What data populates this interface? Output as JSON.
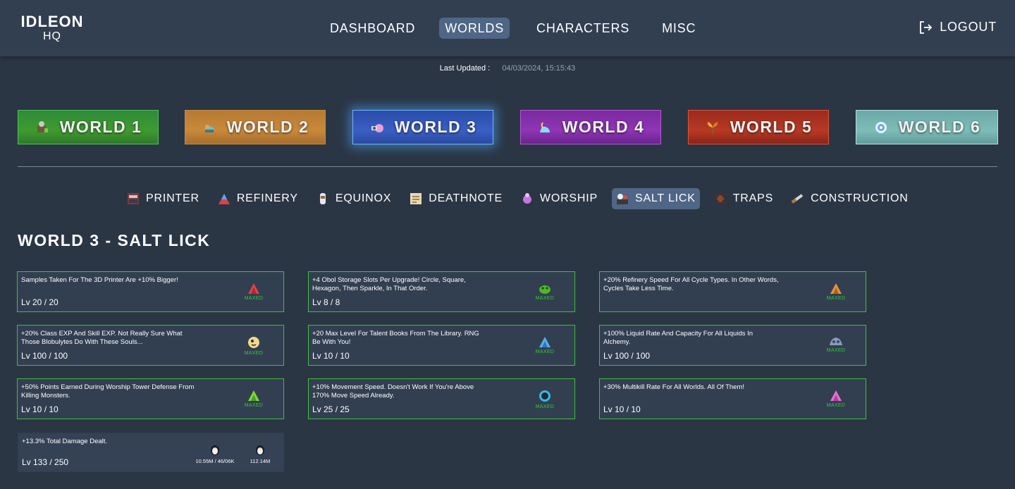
{
  "header": {
    "logo_line1": "IDLEON",
    "logo_line2": "HQ",
    "nav": [
      {
        "label": "DASHBOARD",
        "active": false
      },
      {
        "label": "WORLDS",
        "active": true
      },
      {
        "label": "CHARACTERS",
        "active": false
      },
      {
        "label": "MISC",
        "active": false
      }
    ],
    "logout_label": "LOGOUT"
  },
  "last_updated": {
    "label": "Last Updated :",
    "value": "04/03/2024, 15:15:43"
  },
  "worlds": [
    {
      "label": "WORLD 1",
      "icon": "world1-icon",
      "color": "#3f9b2f"
    },
    {
      "label": "WORLD 2",
      "icon": "world2-icon",
      "color": "#c9893a"
    },
    {
      "label": "WORLD 3",
      "icon": "world3-icon",
      "color": "#3a5fc4",
      "active": true
    },
    {
      "label": "WORLD 4",
      "icon": "world4-icon",
      "color": "#8f36b4"
    },
    {
      "label": "WORLD 5",
      "icon": "world5-icon",
      "color": "#b83a24"
    },
    {
      "label": "WORLD 6",
      "icon": "world6-icon",
      "color": "#7ebcb8"
    }
  ],
  "subnav": [
    {
      "label": "PRINTER",
      "icon": "printer-icon"
    },
    {
      "label": "REFINERY",
      "icon": "refinery-icon"
    },
    {
      "label": "EQUINOX",
      "icon": "equinox-icon"
    },
    {
      "label": "DEATHNOTE",
      "icon": "deathnote-icon"
    },
    {
      "label": "WORSHIP",
      "icon": "worship-icon"
    },
    {
      "label": "SALT LICK",
      "icon": "salt-lick-icon",
      "active": true
    },
    {
      "label": "TRAPS",
      "icon": "traps-icon"
    },
    {
      "label": "CONSTRUCTION",
      "icon": "construction-icon"
    }
  ],
  "page_title": "WORLD 3 - SALT LICK",
  "maxed_label": "MAXED",
  "colors": {
    "maxed_border": "#3fbf3f",
    "maxed_text": "#36c936",
    "background": "#2b3645",
    "panel": "#323f51",
    "active_tab": "#4f6686"
  },
  "cards": [
    {
      "desc": "Samples Taken For The 3D Printer Are +10% Bigger!",
      "level": "Lv 20 / 20",
      "icon": "red-salt-icon"
    },
    {
      "desc": "+4 Obol Storage Slots Per Upgrade! Circle, Square, Hexagon, Then Sparkle, In That Order.",
      "level": "Lv 8 / 8",
      "icon": "green-slime-icon"
    },
    {
      "desc": "+20% Refinery Speed For All Cycle Types. In Other Words, Cycles Take Less Time.",
      "level": "",
      "icon": "orange-salt-icon"
    },
    {
      "desc": "+20% Class EXP And Skill EXP. Not Really Sure What Those Blobulytes Do With These Souls...",
      "level": "Lv 100 / 100",
      "icon": "soul-icon"
    },
    {
      "desc": "+20 Max Level For Talent Books From The Library. RNG Be With You!",
      "level": "Lv 10 / 10",
      "icon": "blue-salt-icon"
    },
    {
      "desc": "+100% Liquid Rate And Capacity For All Liquids In Alchemy.",
      "level": "Lv 100 / 100",
      "icon": "crystal-rock-icon"
    },
    {
      "desc": "+50% Points Earned During Worship Tower Defense From Killing Monsters.",
      "level": "Lv 10 / 10",
      "icon": "green-salt-icon"
    },
    {
      "desc": "+10% Movement Speed. Doesn't Work If You're Above 170% Move Speed Already.",
      "level": "Lv 25 / 25",
      "icon": "portal-icon"
    },
    {
      "desc": "+30% Multikill Rate For All Worlds. All Of Them!",
      "level": "Lv 10 / 10",
      "icon": "pink-salt-icon"
    }
  ],
  "last_card": {
    "desc": "+13.3% Total Damage Dealt.",
    "level": "Lv 133 / 250",
    "costs": [
      {
        "amount": "10.55M / 46/06K",
        "icon": "penguin-icon"
      },
      {
        "amount": "112.14M",
        "icon": "penguin-icon"
      }
    ]
  }
}
